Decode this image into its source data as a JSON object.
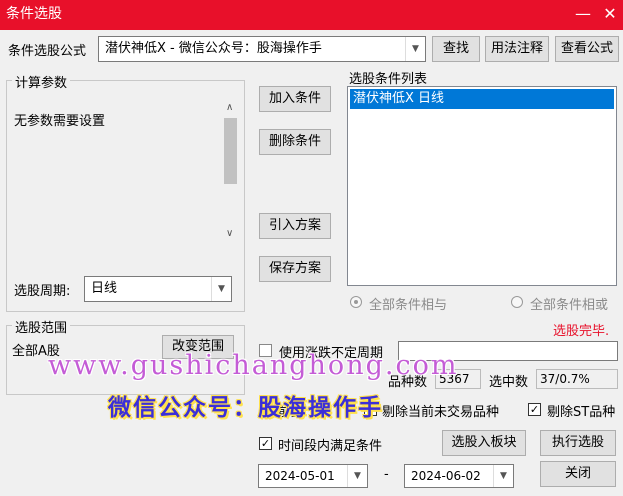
{
  "window": {
    "title": "条件选股",
    "minimize_glyph": "—",
    "close_glyph": "✕"
  },
  "formula": {
    "label": "条件选股公式",
    "value": "潜伏神低X  -  微信公众号：股海操作手",
    "find_button": "查找",
    "usage_button": "用法注释",
    "view_button": "查看公式"
  },
  "params": {
    "group_title": "计算参数",
    "text": "无参数需要设置",
    "period_label": "选股周期:",
    "period_value": "日线"
  },
  "actions": {
    "add": "加入条件",
    "delete": "删除条件",
    "import": "引入方案",
    "save": "保存方案"
  },
  "condition_list": {
    "title": "选股条件列表",
    "items": [
      "潜伏神低X  日线"
    ]
  },
  "logic": {
    "all_and": "全部条件相与",
    "all_or": "全部条件相或"
  },
  "status": {
    "text": "选股完毕.",
    "color": "#e8102a"
  },
  "scope": {
    "group_title": "选股范围",
    "value": "全部A股",
    "change_button": "改变范围"
  },
  "options": {
    "uncertain_period": "使用涨跌不定周期",
    "delete_nontrade": "剔除当前未交易品种",
    "delete_st": "剔除ST品种",
    "prefix_partial": "前复",
    "within_period": "时间段内满足条件"
  },
  "stats": {
    "count_label": "品种数",
    "count_value": "5367",
    "selected_label": "选中数",
    "selected_value": "37/0.7%"
  },
  "bottom": {
    "to_block_button": "选股入板块",
    "execute_button": "执行选股",
    "close_button": "关闭",
    "date_from": "2024-05-01",
    "date_sep": "-",
    "date_to": "2024-06-02"
  },
  "watermark": {
    "url": "www.gushichanghong.com",
    "wechat": "微信公众号：股海操作手"
  },
  "colors": {
    "titlebar": "#e8102a",
    "selection": "#0078d7"
  }
}
